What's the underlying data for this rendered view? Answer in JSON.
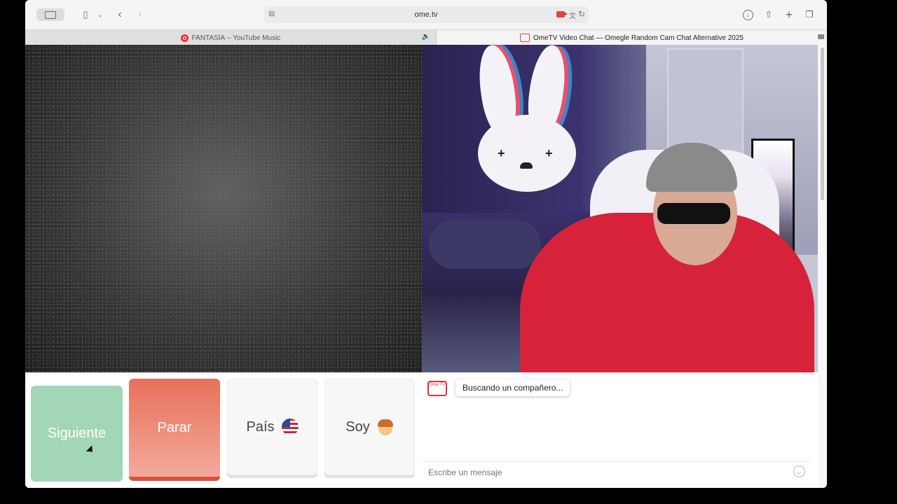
{
  "browser": {
    "url": "ome.tv",
    "tabs": [
      {
        "title": "FANTASÍA",
        "subtitle": "– YouTube Music"
      },
      {
        "title": "OmeTV Video Chat — Omegle Random Cam Chat Alternative 2025"
      }
    ],
    "icons": [
      "sidebar-icon",
      "back-icon",
      "forward-icon",
      "download-icon",
      "share-icon",
      "new-tab-icon",
      "tab-overview-icon"
    ]
  },
  "controls": {
    "next_label": "Siguiente",
    "stop_label": "Parar",
    "country_label": "País",
    "gender_label": "Soy",
    "colors": {
      "next": "#a2d6b6",
      "stop": "#e7705a"
    }
  },
  "chat": {
    "logo_text": "Ome TV",
    "status_message": "Buscando un compañero...",
    "input_placeholder": "Escribe un mensaje"
  }
}
